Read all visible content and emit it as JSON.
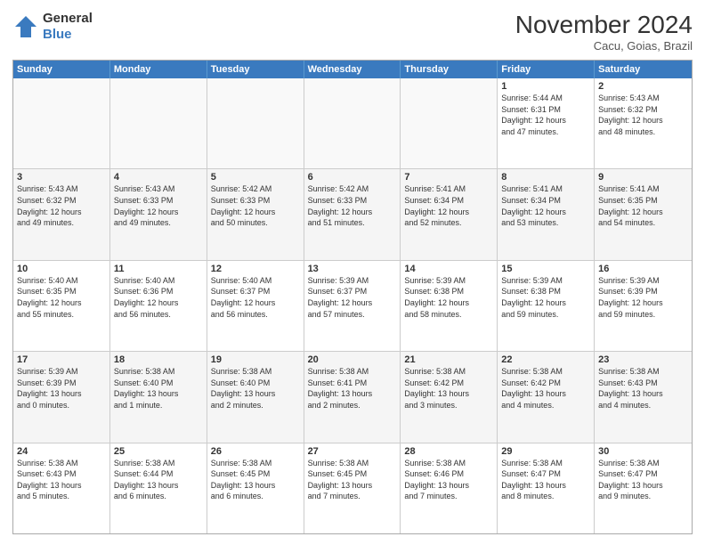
{
  "logo": {
    "line1": "General",
    "line2": "Blue"
  },
  "title": "November 2024",
  "location": "Cacu, Goias, Brazil",
  "days_of_week": [
    "Sunday",
    "Monday",
    "Tuesday",
    "Wednesday",
    "Thursday",
    "Friday",
    "Saturday"
  ],
  "weeks": [
    [
      {
        "day": "",
        "info": "",
        "empty": true
      },
      {
        "day": "",
        "info": "",
        "empty": true
      },
      {
        "day": "",
        "info": "",
        "empty": true
      },
      {
        "day": "",
        "info": "",
        "empty": true
      },
      {
        "day": "",
        "info": "",
        "empty": true
      },
      {
        "day": "1",
        "info": "Sunrise: 5:44 AM\nSunset: 6:31 PM\nDaylight: 12 hours\nand 47 minutes.",
        "empty": false
      },
      {
        "day": "2",
        "info": "Sunrise: 5:43 AM\nSunset: 6:32 PM\nDaylight: 12 hours\nand 48 minutes.",
        "empty": false
      }
    ],
    [
      {
        "day": "3",
        "info": "Sunrise: 5:43 AM\nSunset: 6:32 PM\nDaylight: 12 hours\nand 49 minutes.",
        "empty": false
      },
      {
        "day": "4",
        "info": "Sunrise: 5:43 AM\nSunset: 6:33 PM\nDaylight: 12 hours\nand 49 minutes.",
        "empty": false
      },
      {
        "day": "5",
        "info": "Sunrise: 5:42 AM\nSunset: 6:33 PM\nDaylight: 12 hours\nand 50 minutes.",
        "empty": false
      },
      {
        "day": "6",
        "info": "Sunrise: 5:42 AM\nSunset: 6:33 PM\nDaylight: 12 hours\nand 51 minutes.",
        "empty": false
      },
      {
        "day": "7",
        "info": "Sunrise: 5:41 AM\nSunset: 6:34 PM\nDaylight: 12 hours\nand 52 minutes.",
        "empty": false
      },
      {
        "day": "8",
        "info": "Sunrise: 5:41 AM\nSunset: 6:34 PM\nDaylight: 12 hours\nand 53 minutes.",
        "empty": false
      },
      {
        "day": "9",
        "info": "Sunrise: 5:41 AM\nSunset: 6:35 PM\nDaylight: 12 hours\nand 54 minutes.",
        "empty": false
      }
    ],
    [
      {
        "day": "10",
        "info": "Sunrise: 5:40 AM\nSunset: 6:35 PM\nDaylight: 12 hours\nand 55 minutes.",
        "empty": false
      },
      {
        "day": "11",
        "info": "Sunrise: 5:40 AM\nSunset: 6:36 PM\nDaylight: 12 hours\nand 56 minutes.",
        "empty": false
      },
      {
        "day": "12",
        "info": "Sunrise: 5:40 AM\nSunset: 6:37 PM\nDaylight: 12 hours\nand 56 minutes.",
        "empty": false
      },
      {
        "day": "13",
        "info": "Sunrise: 5:39 AM\nSunset: 6:37 PM\nDaylight: 12 hours\nand 57 minutes.",
        "empty": false
      },
      {
        "day": "14",
        "info": "Sunrise: 5:39 AM\nSunset: 6:38 PM\nDaylight: 12 hours\nand 58 minutes.",
        "empty": false
      },
      {
        "day": "15",
        "info": "Sunrise: 5:39 AM\nSunset: 6:38 PM\nDaylight: 12 hours\nand 59 minutes.",
        "empty": false
      },
      {
        "day": "16",
        "info": "Sunrise: 5:39 AM\nSunset: 6:39 PM\nDaylight: 12 hours\nand 59 minutes.",
        "empty": false
      }
    ],
    [
      {
        "day": "17",
        "info": "Sunrise: 5:39 AM\nSunset: 6:39 PM\nDaylight: 13 hours\nand 0 minutes.",
        "empty": false
      },
      {
        "day": "18",
        "info": "Sunrise: 5:38 AM\nSunset: 6:40 PM\nDaylight: 13 hours\nand 1 minute.",
        "empty": false
      },
      {
        "day": "19",
        "info": "Sunrise: 5:38 AM\nSunset: 6:40 PM\nDaylight: 13 hours\nand 2 minutes.",
        "empty": false
      },
      {
        "day": "20",
        "info": "Sunrise: 5:38 AM\nSunset: 6:41 PM\nDaylight: 13 hours\nand 2 minutes.",
        "empty": false
      },
      {
        "day": "21",
        "info": "Sunrise: 5:38 AM\nSunset: 6:42 PM\nDaylight: 13 hours\nand 3 minutes.",
        "empty": false
      },
      {
        "day": "22",
        "info": "Sunrise: 5:38 AM\nSunset: 6:42 PM\nDaylight: 13 hours\nand 4 minutes.",
        "empty": false
      },
      {
        "day": "23",
        "info": "Sunrise: 5:38 AM\nSunset: 6:43 PM\nDaylight: 13 hours\nand 4 minutes.",
        "empty": false
      }
    ],
    [
      {
        "day": "24",
        "info": "Sunrise: 5:38 AM\nSunset: 6:43 PM\nDaylight: 13 hours\nand 5 minutes.",
        "empty": false
      },
      {
        "day": "25",
        "info": "Sunrise: 5:38 AM\nSunset: 6:44 PM\nDaylight: 13 hours\nand 6 minutes.",
        "empty": false
      },
      {
        "day": "26",
        "info": "Sunrise: 5:38 AM\nSunset: 6:45 PM\nDaylight: 13 hours\nand 6 minutes.",
        "empty": false
      },
      {
        "day": "27",
        "info": "Sunrise: 5:38 AM\nSunset: 6:45 PM\nDaylight: 13 hours\nand 7 minutes.",
        "empty": false
      },
      {
        "day": "28",
        "info": "Sunrise: 5:38 AM\nSunset: 6:46 PM\nDaylight: 13 hours\nand 7 minutes.",
        "empty": false
      },
      {
        "day": "29",
        "info": "Sunrise: 5:38 AM\nSunset: 6:47 PM\nDaylight: 13 hours\nand 8 minutes.",
        "empty": false
      },
      {
        "day": "30",
        "info": "Sunrise: 5:38 AM\nSunset: 6:47 PM\nDaylight: 13 hours\nand 9 minutes.",
        "empty": false
      }
    ]
  ]
}
